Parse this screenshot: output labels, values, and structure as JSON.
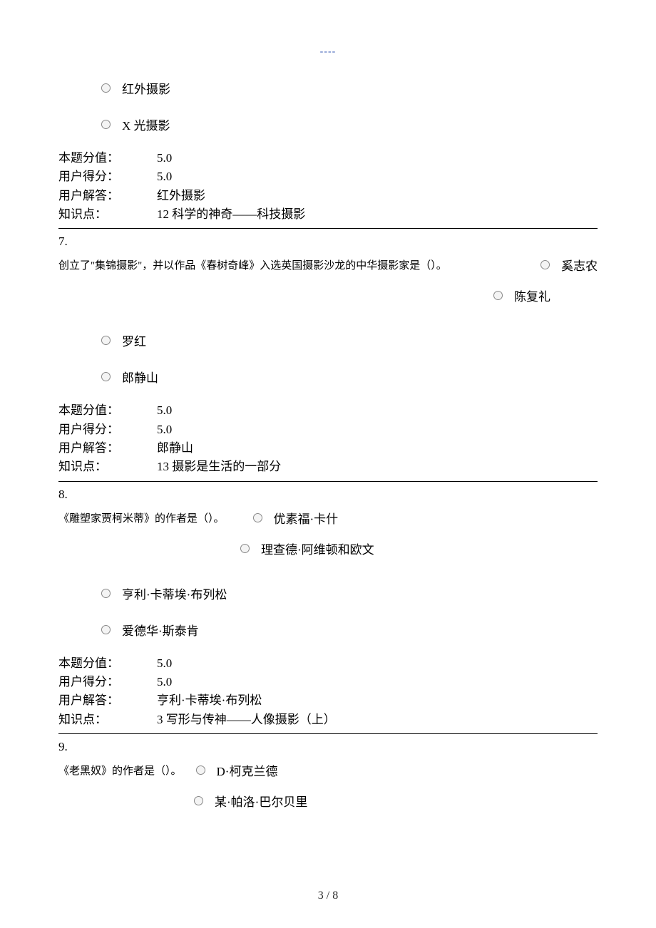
{
  "header_dashes": "----",
  "labels": {
    "score": "本题分值：",
    "user_score": "用户得分：",
    "user_answer": "用户解答：",
    "knowledge": "知识点："
  },
  "q6": {
    "options": [
      "红外摄影",
      "X 光摄影"
    ],
    "score": "5.0",
    "user_score": "5.0",
    "user_answer": "红外摄影",
    "knowledge": "12 科学的神奇——科技摄影"
  },
  "q7": {
    "number": "7.",
    "prompt": "创立了\"集锦摄影\"，并以作品《春树奇峰》入选英国摄影沙龙的中华摄影家是（）。",
    "options": [
      "奚志农",
      "陈复礼",
      "罗红",
      "郎静山"
    ],
    "score": "5.0",
    "user_score": "5.0",
    "user_answer": "郎静山",
    "knowledge": "13 摄影是生活的一部分"
  },
  "q8": {
    "number": "8.",
    "prompt": "《雕塑家贾柯米蒂》的作者是（）。",
    "options": [
      "优素福·卡什",
      "理查德·阿维顿和欧文",
      "亨利·卡蒂埃·布列松",
      "爱德华·斯泰肯"
    ],
    "score": "5.0",
    "user_score": "5.0",
    "user_answer": "亨利·卡蒂埃·布列松",
    "knowledge": "3 写形与传神——人像摄影（上）"
  },
  "q9": {
    "number": "9.",
    "prompt": "《老黑奴》的作者是（）。",
    "options": [
      "D·柯克兰德",
      "某·帕洛·巴尔贝里"
    ]
  },
  "footer": "3 / 8"
}
